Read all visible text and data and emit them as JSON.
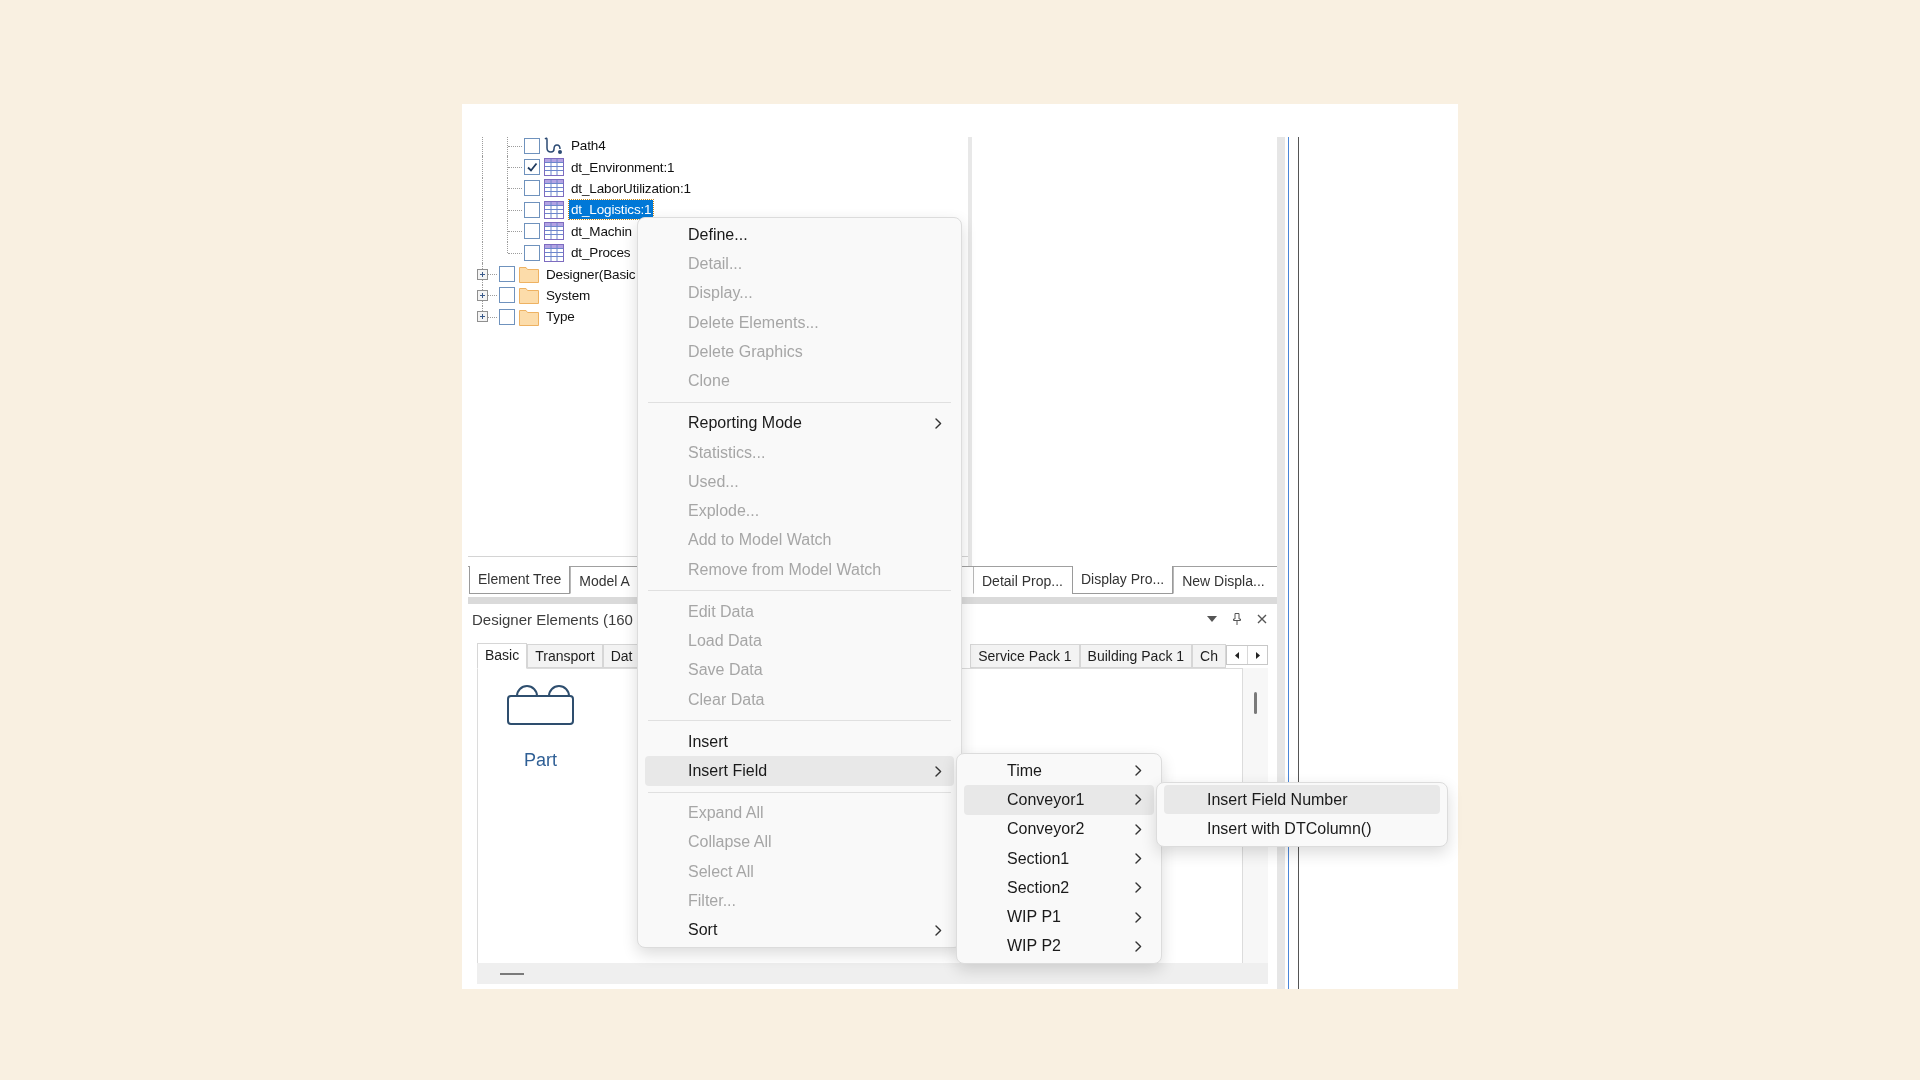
{
  "tree": {
    "items": [
      {
        "children": [
          {
            "kind": "path",
            "label": "Path4",
            "checked": false,
            "selected": false
          },
          {
            "kind": "table",
            "label": "dt_Environment:1",
            "checked": true,
            "selected": false
          },
          {
            "kind": "table",
            "label": "dt_LaborUtilization:1",
            "checked": false,
            "selected": false
          },
          {
            "kind": "table",
            "label": "dt_Logistics:1",
            "checked": false,
            "selected": true
          },
          {
            "kind": "table",
            "label": "dt_Machin",
            "checked": false,
            "selected": false
          },
          {
            "kind": "table",
            "label": "dt_Proces",
            "checked": false,
            "selected": false
          }
        ]
      },
      {
        "kind": "folder",
        "label": "Designer(Basic",
        "expanded": false,
        "checked": false,
        "selected": false
      },
      {
        "kind": "folder",
        "label": "System",
        "expanded": false,
        "checked": false,
        "selected": false
      },
      {
        "kind": "folder",
        "label": "Type",
        "expanded": false,
        "checked": false,
        "selected": false
      }
    ]
  },
  "tree_tabs": [
    {
      "label": "Element Tree",
      "selected": true
    },
    {
      "label": "Model A",
      "selected": false
    }
  ],
  "properties_tabs": [
    {
      "label": "Detail Prop...",
      "selected": false
    },
    {
      "label": "Display Pro...",
      "selected": true
    },
    {
      "label": "New Displa...",
      "selected": false
    }
  ],
  "designer_elements": {
    "title": "Designer Elements (160",
    "tab_groups": [
      {
        "tabs": [
          {
            "label": "Basic",
            "selected": true
          },
          {
            "label": "Transport",
            "selected": false
          },
          {
            "label": "Dat",
            "selected": false
          }
        ]
      },
      {
        "tabs": [
          {
            "label": "Service Pack 1",
            "selected": false
          },
          {
            "label": "Building Pack 1",
            "selected": false
          },
          {
            "label": "Ch",
            "selected": false
          }
        ]
      }
    ],
    "items": [
      {
        "kind": "part",
        "label": "Part"
      }
    ]
  },
  "context_menu": {
    "items": [
      {
        "kind": "item",
        "label": "Define...",
        "disabled": false,
        "selected": false
      },
      {
        "kind": "item",
        "label": "Detail...",
        "disabled": true,
        "selected": false
      },
      {
        "kind": "item",
        "label": "Display...",
        "disabled": true,
        "selected": false
      },
      {
        "kind": "item",
        "label": "Delete Elements...",
        "disabled": true,
        "selected": false
      },
      {
        "kind": "item",
        "label": "Delete Graphics",
        "disabled": true,
        "selected": false
      },
      {
        "kind": "item",
        "label": "Clone",
        "disabled": true,
        "selected": false
      },
      {
        "kind": "separator"
      },
      {
        "kind": "submenu",
        "label": "Reporting Mode",
        "disabled": false,
        "selected": false
      },
      {
        "kind": "item",
        "label": "Statistics...",
        "disabled": true,
        "selected": false
      },
      {
        "kind": "item",
        "label": "Used...",
        "disabled": true,
        "selected": false
      },
      {
        "kind": "item",
        "label": "Explode...",
        "disabled": true,
        "selected": false
      },
      {
        "kind": "item",
        "label": "Add to Model Watch",
        "disabled": true,
        "selected": false
      },
      {
        "kind": "item",
        "label": "Remove from Model Watch",
        "disabled": true,
        "selected": false
      },
      {
        "kind": "separator"
      },
      {
        "kind": "item",
        "label": "Edit Data",
        "disabled": true,
        "selected": false
      },
      {
        "kind": "item",
        "label": "Load Data",
        "disabled": true,
        "selected": false
      },
      {
        "kind": "item",
        "label": "Save Data",
        "disabled": true,
        "selected": false
      },
      {
        "kind": "item",
        "label": "Clear Data",
        "disabled": true,
        "selected": false
      },
      {
        "kind": "separator"
      },
      {
        "kind": "item",
        "label": "Insert",
        "disabled": false,
        "selected": false
      },
      {
        "kind": "submenu",
        "label": "Insert Field",
        "disabled": false,
        "selected": true
      },
      {
        "kind": "separator"
      },
      {
        "kind": "item",
        "label": "Expand All",
        "disabled": true,
        "selected": false
      },
      {
        "kind": "item",
        "label": "Collapse All",
        "disabled": true,
        "selected": false
      },
      {
        "kind": "item",
        "label": "Select All",
        "disabled": true,
        "selected": false
      },
      {
        "kind": "item",
        "label": "Filter...",
        "disabled": true,
        "selected": false
      },
      {
        "kind": "submenu",
        "label": "Sort",
        "disabled": false,
        "selected": false
      }
    ]
  },
  "field_submenu": {
    "items": [
      {
        "kind": "submenu",
        "label": "Time",
        "selected": false
      },
      {
        "kind": "submenu",
        "label": "Conveyor1",
        "selected": true
      },
      {
        "kind": "submenu",
        "label": "Conveyor2",
        "selected": false
      },
      {
        "kind": "submenu",
        "label": "Section1",
        "selected": false
      },
      {
        "kind": "submenu",
        "label": "Section2",
        "selected": false
      },
      {
        "kind": "submenu",
        "label": "WIP P1",
        "selected": false
      },
      {
        "kind": "submenu",
        "label": "WIP P2",
        "selected": false
      }
    ]
  },
  "conveyor_submenu": {
    "items": [
      {
        "kind": "item",
        "label": "Insert Field Number",
        "selected": true
      },
      {
        "kind": "item",
        "label": "Insert with DTColumn()",
        "selected": false
      }
    ]
  }
}
